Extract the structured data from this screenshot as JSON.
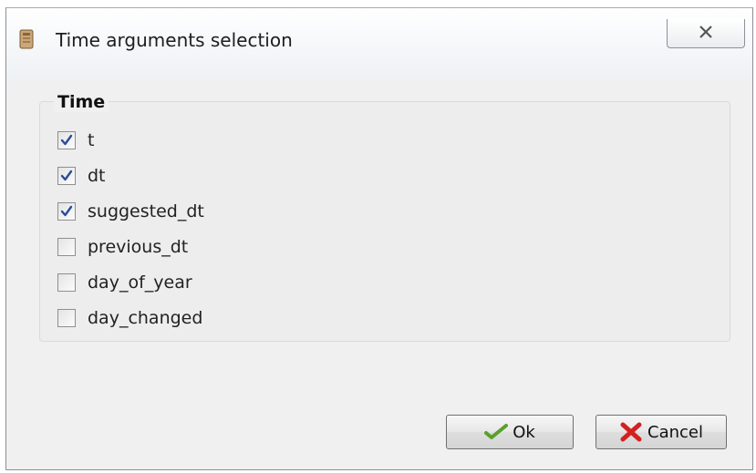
{
  "window": {
    "title": "Time arguments selection",
    "icons": {
      "app": "app-icon",
      "close": "close-icon"
    }
  },
  "group": {
    "title": "Time",
    "items": [
      {
        "label": "t",
        "checked": true
      },
      {
        "label": "dt",
        "checked": true
      },
      {
        "label": "suggested_dt",
        "checked": true
      },
      {
        "label": "previous_dt",
        "checked": false
      },
      {
        "label": "day_of_year",
        "checked": false
      },
      {
        "label": "day_changed",
        "checked": false
      }
    ]
  },
  "buttons": {
    "ok": {
      "label": "Ok",
      "icon": "checkmark-icon"
    },
    "cancel": {
      "label": "Cancel",
      "icon": "red-x-icon"
    }
  },
  "colors": {
    "checkmark_blue": "#2b4c9a",
    "ok_green": "#5aa02c",
    "cancel_red": "#d42020"
  }
}
